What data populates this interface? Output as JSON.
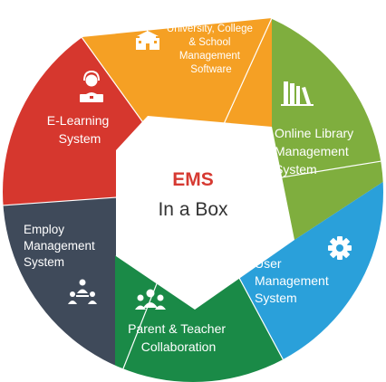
{
  "center": {
    "title": "EMS",
    "subtitle": "In a Box",
    "title_color": "#d63a32",
    "subtitle_color": "#333333"
  },
  "segments": [
    {
      "id": "university",
      "color": "#f5a024",
      "icon": "school-building-icon",
      "lines": [
        "University, College",
        "& School",
        "Management",
        "Software"
      ]
    },
    {
      "id": "library",
      "color": "#7fae3e",
      "icon": "books-icon",
      "lines": [
        "Online Library",
        "Management",
        "System"
      ]
    },
    {
      "id": "user",
      "color": "#2aa0da",
      "icon": "gear-icon",
      "lines": [
        "User",
        "Management",
        "System"
      ]
    },
    {
      "id": "parent",
      "color": "#1a8a47",
      "icon": "people-group-icon",
      "lines": [
        "Parent & Teacher",
        "Collaboration"
      ]
    },
    {
      "id": "employ",
      "color": "#3f4a5a",
      "icon": "team-meeting-icon",
      "lines": [
        "Employ",
        "Management",
        "System"
      ]
    },
    {
      "id": "elearning",
      "color": "#d6372e",
      "icon": "person-laptop-icon",
      "lines": [
        "E-Learning",
        "System"
      ]
    }
  ]
}
